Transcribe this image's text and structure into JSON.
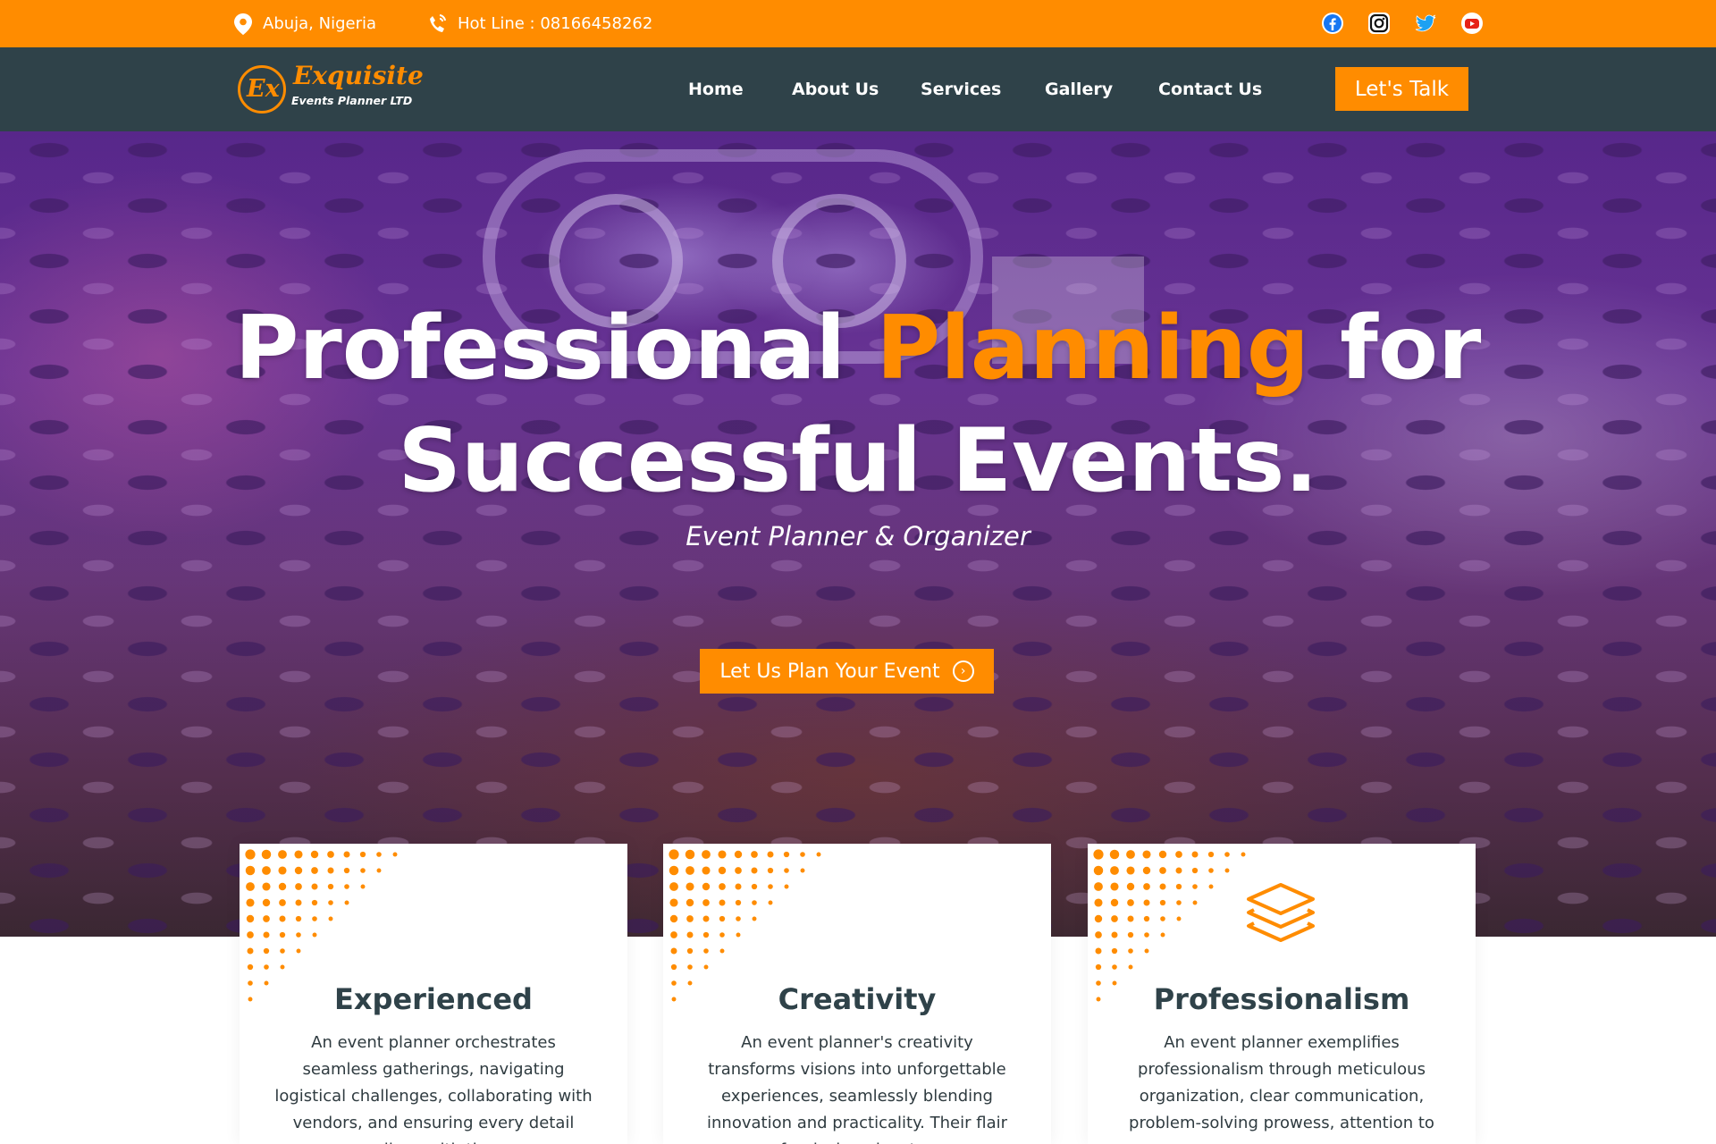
{
  "topbar": {
    "location": "Abuja, Nigeria",
    "hotline": "Hot Line : 08166458262",
    "socials": [
      "facebook-icon",
      "instagram-icon",
      "twitter-icon",
      "youtube-icon"
    ]
  },
  "brand": {
    "mark": "Ex",
    "name": "Exquisite",
    "subtitle": "Events Planner LTD"
  },
  "nav": {
    "items": [
      {
        "label": "Home"
      },
      {
        "label": "About Us"
      },
      {
        "label": "Services"
      },
      {
        "label": "Gallery"
      },
      {
        "label": "Contact Us"
      }
    ],
    "cta": "Let's Talk"
  },
  "hero": {
    "title_part1": "Professional ",
    "title_accent": "Planning",
    "title_part2": " for",
    "title_line2": "Successful Events.",
    "subtitle": "Event Planner & Organizer",
    "button": "Let Us Plan Your Event"
  },
  "features": [
    {
      "title": "Experienced",
      "text": "An event planner orchestrates seamless gatherings, navigating logistical challenges, collaborating with vendors, and ensuring every detail aligns with the"
    },
    {
      "title": "Creativity",
      "text": "An event planner's creativity transforms visions into unforgettable experiences, seamlessly blending innovation and practicality. Their flair for design elevates"
    },
    {
      "title": "Professionalism",
      "text": "An event planner exemplifies professionalism through meticulous organization, clear communication, problem-solving prowess, attention to"
    }
  ],
  "colors": {
    "accent": "#ff8c00",
    "nav_bg": "#2f4249",
    "heading": "#2f4249"
  }
}
